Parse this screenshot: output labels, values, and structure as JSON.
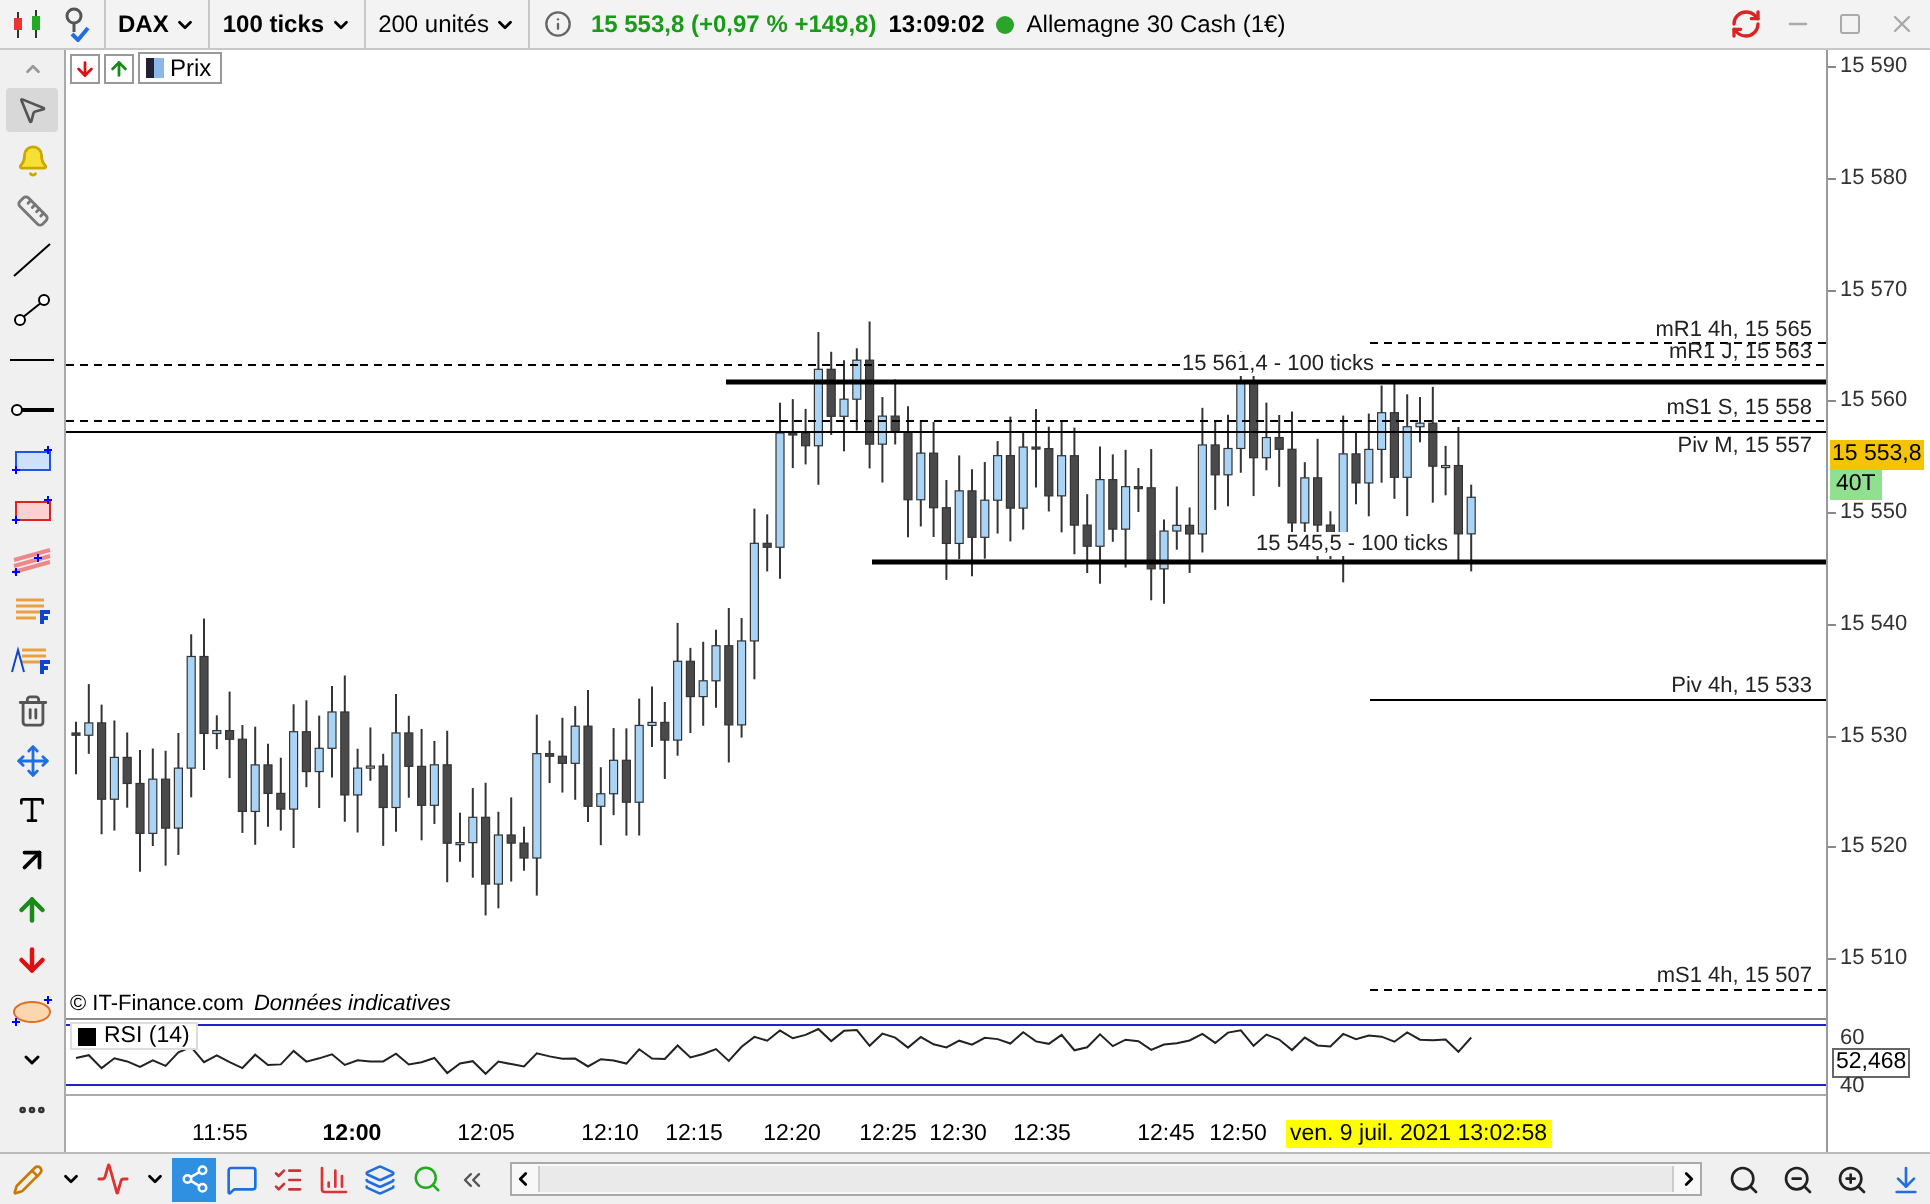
{
  "toolbar": {
    "symbol": "DAX",
    "interval": "100 ticks",
    "units": "200 unités",
    "quote": "15 553,8 (+0,97 % +149,8)",
    "time": "13:09:02",
    "instrument": "Allemagne 30 Cash (1€)"
  },
  "chart_tab": {
    "label": "Prix"
  },
  "levels": [
    {
      "label": "mR1 4h, 15 565",
      "kind": "dashed-short"
    },
    {
      "label": "mR1 J, 15 563",
      "kind": "dashed"
    },
    {
      "label": "15 561,4 - 100 ticks",
      "kind": "thick"
    },
    {
      "label": "mS1 S, 15 558",
      "kind": "dashed"
    },
    {
      "label": "Piv M, 15 557",
      "kind": "solid"
    },
    {
      "label": "15 545,5 - 100 ticks",
      "kind": "thick"
    },
    {
      "label": "Piv 4h, 15 533",
      "kind": "solid-short"
    },
    {
      "label": "mS1 4h, 15 507",
      "kind": "dashed-short"
    }
  ],
  "price_axis": [
    "15 590",
    "15 580",
    "15 570",
    "15 560",
    "15 550",
    "15 540",
    "15 530",
    "15 520",
    "15 510"
  ],
  "last_price": "15 553,8",
  "tick_count": "40T",
  "copyright": "© IT-Finance.com",
  "disclaimer": "Données indicatives",
  "rsi": {
    "label": "RSI (14)",
    "value": "52,468",
    "ticks": [
      "60",
      "40"
    ]
  },
  "time_axis": [
    {
      "label": "11:55",
      "bold": false
    },
    {
      "label": "12:00",
      "bold": true
    },
    {
      "label": "12:05",
      "bold": false
    },
    {
      "label": "12:10",
      "bold": false
    },
    {
      "label": "12:15",
      "bold": false
    },
    {
      "label": "12:20",
      "bold": false
    },
    {
      "label": "12:25",
      "bold": false
    },
    {
      "label": "12:30",
      "bold": false
    },
    {
      "label": "12:35",
      "bold": false
    },
    {
      "label": "12:45",
      "bold": false
    },
    {
      "label": "12:50",
      "bold": false
    }
  ],
  "cursor_date": "ven. 9 juil. 2021 13:02:58"
}
